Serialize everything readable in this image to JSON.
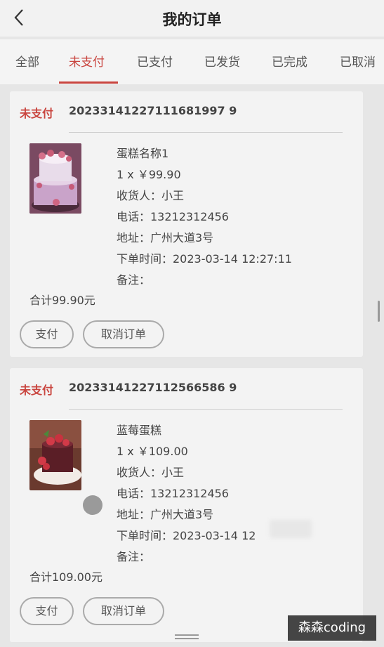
{
  "header": {
    "title": "我的订单"
  },
  "tabs": [
    {
      "label": "全部"
    },
    {
      "label": "未支付"
    },
    {
      "label": "已支付"
    },
    {
      "label": "已发货"
    },
    {
      "label": "已完成"
    },
    {
      "label": "已取消"
    }
  ],
  "orders": [
    {
      "status": "未支付",
      "order_no": "20233141227111681997 9",
      "name": "蛋糕名称1",
      "qty_price": "1 x ￥99.90",
      "recipient": "收货人：小王",
      "phone": "电话：13212312456",
      "address": "地址：广州大道3号",
      "order_time": "下单时间：2023-03-14 12:27:11",
      "note": "备注：",
      "total": "合计99.90元",
      "pay_label": "支付",
      "cancel_label": "取消订单"
    },
    {
      "status": "未支付",
      "order_no": "20233141227112566586 9",
      "name": "蓝莓蛋糕",
      "qty_price": "1 x ￥109.00",
      "recipient": "收货人：小王",
      "phone": "电话：13212312456",
      "address": "地址：广州大道3号",
      "order_time": "下单时间：2023-03-14 12",
      "note": "备注：",
      "total": "合计109.00元",
      "pay_label": "支付",
      "cancel_label": "取消订单"
    }
  ],
  "watermark": "森森coding",
  "colors": {
    "accent": "#c9453f",
    "background": "#e6e6e6",
    "card": "#f3f3f3"
  }
}
